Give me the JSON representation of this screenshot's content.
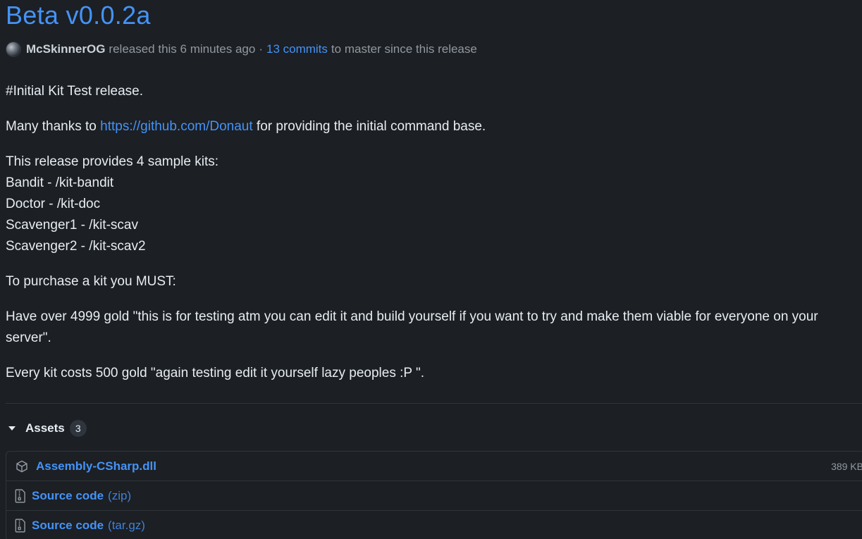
{
  "release": {
    "title": "Beta v0.0.2a",
    "author": "McSkinnerOG",
    "released_text": "released this 6 minutes ago",
    "separator": "·",
    "commits_link": "13 commits",
    "commits_suffix": "to master since this release"
  },
  "body": {
    "heading_line": "#Initial Kit Test release.",
    "thanks_prefix": "Many thanks to",
    "thanks_link": "https://github.com/Donaut",
    "thanks_suffix": "for providing the initial command base.",
    "kits_intro": "This release provides 4 sample kits:",
    "kits": [
      "Bandit - /kit-bandit",
      "Doctor - /kit-doc",
      "Scavenger1 - /kit-scav",
      "Scavenger2 - /kit-scav2"
    ],
    "purchase_intro": "To purchase a kit you MUST:",
    "requirement": "Have over 4999 gold \"this is for testing atm you can edit it and build yourself if you want to try and make them viable for everyone on your server\".",
    "cost": "Every kit costs 500 gold \"again testing edit it yourself lazy peoples :P \"."
  },
  "assets": {
    "label": "Assets",
    "count": "3",
    "items": [
      {
        "name": "Assembly-CSharp.dll",
        "sub": "",
        "size": "389 KB",
        "icon": "package-icon"
      },
      {
        "name": "Source code",
        "sub": "(zip)",
        "size": "",
        "icon": "file-zip-icon"
      },
      {
        "name": "Source code",
        "sub": "(tar.gz)",
        "size": "",
        "icon": "file-zip-icon"
      }
    ]
  },
  "colors": {
    "background": "#1c1f23",
    "link": "#4493f8",
    "muted": "#9198a1",
    "border": "#30363d"
  }
}
